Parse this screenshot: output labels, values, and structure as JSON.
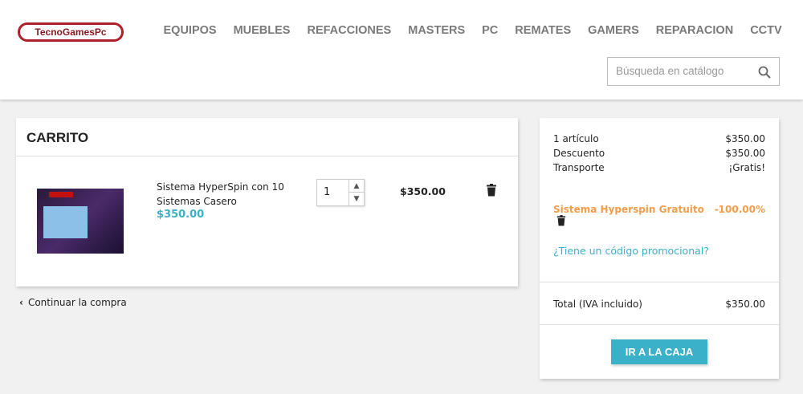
{
  "header": {
    "logo": "TecnoGamesPc",
    "nav": [
      "EQUIPOS",
      "MUEBLES",
      "REFACCIONES",
      "MASTERS",
      "PC",
      "REMATES",
      "GAMERS",
      "REPARACION",
      "CCTV"
    ],
    "search_placeholder": "Búsqueda en catálogo"
  },
  "cart": {
    "title": "CARRITO",
    "item": {
      "name": "Sistema HyperSpin con 10 Sistemas Casero",
      "price": "$350.00",
      "quantity": "1",
      "total": "$350.00"
    },
    "continue": "Continuar la compra"
  },
  "summary": {
    "items_label": "1 artículo",
    "items_value": "$350.00",
    "discount_label": "Descuento",
    "discount_value": "$350.00",
    "shipping_label": "Transporte",
    "shipping_value": "¡Gratis!",
    "voucher_name": "Sistema Hyperspin Gratuito",
    "voucher_value": "-100.00%",
    "promo_link": "¿Tiene un código promocional?",
    "total_label": "Total (IVA incluido)",
    "total_value": "$350.00",
    "checkout": "IR A LA CAJA"
  },
  "colors": {
    "accent": "#3bb0c9",
    "voucher": "#f39d4b",
    "logo": "#b0202a"
  }
}
